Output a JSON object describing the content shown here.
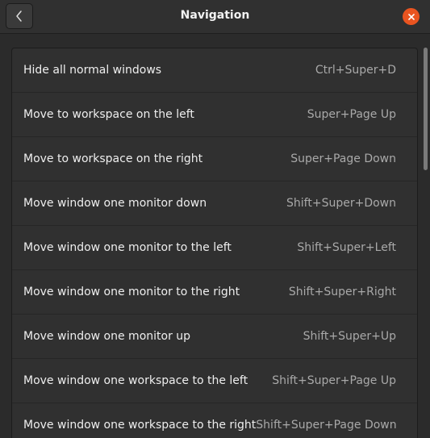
{
  "header": {
    "title": "Navigation",
    "back_icon": "chevron-left-icon",
    "close_icon": "close-icon",
    "close_color": "#e95420"
  },
  "shortcuts": [
    {
      "name": "Hide all normal windows",
      "accel": "Ctrl+Super+D"
    },
    {
      "name": "Move to workspace on the left",
      "accel": "Super+Page Up"
    },
    {
      "name": "Move to workspace on the right",
      "accel": "Super+Page Down"
    },
    {
      "name": "Move window one monitor down",
      "accel": "Shift+Super+Down"
    },
    {
      "name": "Move window one monitor to the left",
      "accel": "Shift+Super+Left"
    },
    {
      "name": "Move window one monitor to the right",
      "accel": "Shift+Super+Right"
    },
    {
      "name": "Move window one monitor up",
      "accel": "Shift+Super+Up"
    },
    {
      "name": "Move window one workspace to the left",
      "accel": "Shift+Super+Page Up"
    },
    {
      "name": "Move window one workspace to the right",
      "accel": "Shift+Super+Page Down"
    }
  ]
}
